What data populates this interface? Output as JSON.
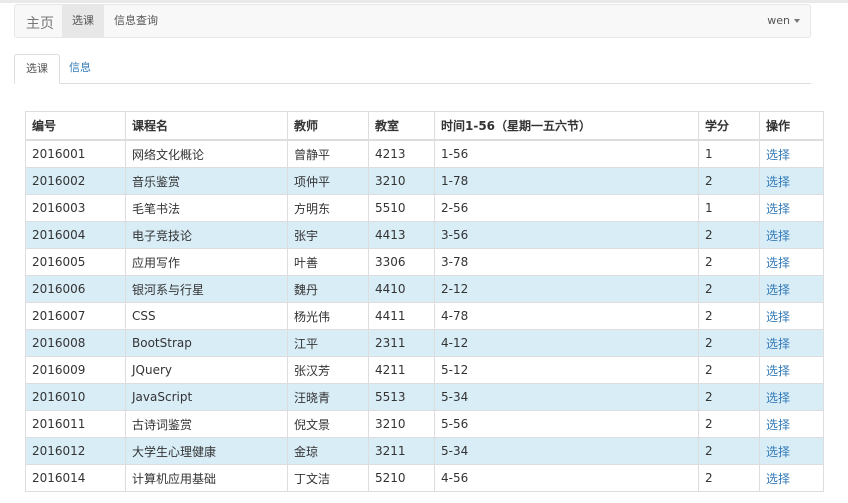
{
  "navbar": {
    "brand": "主页",
    "items": [
      {
        "label": "选课"
      },
      {
        "label": "信息查询"
      }
    ],
    "user": "wen"
  },
  "tabs": [
    {
      "label": "选课"
    },
    {
      "label": "信息"
    }
  ],
  "table": {
    "headers": [
      "编号",
      "课程名",
      "教师",
      "教室",
      "时间1-56（星期一五六节）",
      "学分",
      "操作"
    ],
    "rows": [
      [
        "2016001",
        "网络文化概论",
        "曾静平",
        "4213",
        "1-56",
        "1",
        "选择"
      ],
      [
        "2016002",
        "音乐鉴赏",
        "项仲平",
        "3210",
        "1-78",
        "2",
        "选择"
      ],
      [
        "2016003",
        "毛笔书法",
        "方明东",
        "5510",
        "2-56",
        "1",
        "选择"
      ],
      [
        "2016004",
        "电子竞技论",
        "张宇",
        "4413",
        "3-56",
        "2",
        "选择"
      ],
      [
        "2016005",
        "应用写作",
        "叶善",
        "3306",
        "3-78",
        "2",
        "选择"
      ],
      [
        "2016006",
        "银河系与行星",
        "魏丹",
        "4410",
        "2-12",
        "2",
        "选择"
      ],
      [
        "2016007",
        "CSS",
        "杨光伟",
        "4411",
        "4-78",
        "2",
        "选择"
      ],
      [
        "2016008",
        "BootStrap",
        "江平",
        "2311",
        "4-12",
        "2",
        "选择"
      ],
      [
        "2016009",
        "JQuery",
        "张汉芳",
        "4211",
        "5-12",
        "2",
        "选择"
      ],
      [
        "2016010",
        "JavaScript",
        "汪晓青",
        "5513",
        "5-34",
        "2",
        "选择"
      ],
      [
        "2016011",
        "古诗词鉴赏",
        "倪文景",
        "3210",
        "5-56",
        "2",
        "选择"
      ],
      [
        "2016012",
        "大学生心理健康",
        "金琼",
        "3211",
        "5-34",
        "2",
        "选择"
      ],
      [
        "2016014",
        "计算机应用基础",
        "丁文洁",
        "5210",
        "4-56",
        "2",
        "选择"
      ]
    ]
  },
  "colors": {
    "navbar_bg": "#f8f8f8",
    "link": "#337ab7",
    "row_highlight": "#d9edf7",
    "border": "#dddddd"
  }
}
